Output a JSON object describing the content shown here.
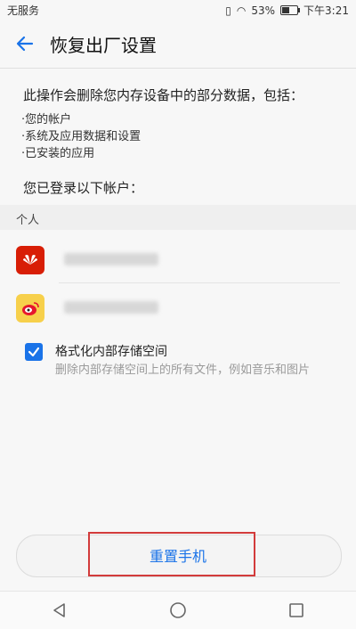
{
  "status_bar": {
    "carrier": "无服务",
    "battery": "53%",
    "battery_level": 0.53,
    "time": "下午3:21"
  },
  "header": {
    "title": "恢复出厂设置"
  },
  "intro": "此操作会删除您内存设备中的部分数据，包括：",
  "bullets": [
    "·您的帐户",
    "·系统及应用数据和设置",
    "·已安装的应用"
  ],
  "logged_in": "您已登录以下帐户：",
  "section_personal": "个人",
  "accounts": [
    {
      "icon": "huawei-icon",
      "color": "#d81e06"
    },
    {
      "icon": "weibo-icon",
      "color": "#f7d04b"
    }
  ],
  "format_option": {
    "label": "格式化内部存储空间",
    "description": "删除内部存储空间上的所有文件，例如音乐和图片",
    "checked": true
  },
  "reset_button": "重置手机",
  "colors": {
    "accent": "#1a73e8",
    "highlight": "#d23b3b"
  }
}
